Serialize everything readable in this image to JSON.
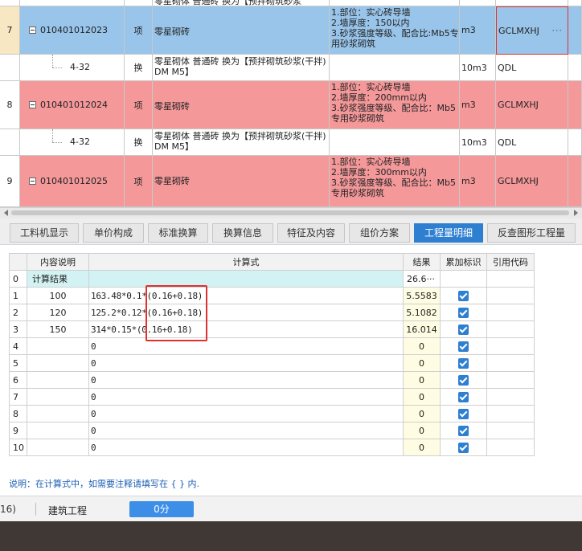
{
  "upper_grid": {
    "rows": [
      {
        "type": "partial",
        "name": "零星砌体 普通砖  换为【预拌砌筑砂浆"
      },
      {
        "type": "main",
        "style": "blue",
        "num": "7",
        "code": "010401012023",
        "category": "项",
        "name": "零星砌砖",
        "features": [
          "1.部位：实心砖导墙",
          "2.墙厚度：150以内",
          "3.砂浆强度等级、配合比:Mb5专用砂浆砌筑"
        ],
        "unit": "m3",
        "expr": "GCLMXHJ"
      },
      {
        "type": "sub",
        "num": "",
        "code": "4-32",
        "category": "换",
        "name": "零星砌体 普通砖  换为【预拌砌筑砂浆(干拌) DM M5】",
        "features": [],
        "unit": "10m3",
        "expr": "QDL"
      },
      {
        "type": "main",
        "style": "red",
        "num": "8",
        "code": "010401012024",
        "category": "项",
        "name": "零星砌砖",
        "features": [
          "1.部位：实心砖导墙",
          "2.墙厚度：200mm以内",
          "3.砂浆强度等级、配合比：Mb5专用砂浆砌筑"
        ],
        "unit": "m3",
        "expr": "GCLMXHJ"
      },
      {
        "type": "sub",
        "num": "",
        "code": "4-32",
        "category": "换",
        "name": "零星砌体 普通砖  换为【预拌砌筑砂浆(干拌) DM M5】",
        "features": [],
        "unit": "10m3",
        "expr": "QDL"
      },
      {
        "type": "main",
        "style": "red",
        "num": "9",
        "code": "010401012025",
        "category": "项",
        "name": "零星砌砖",
        "features": [
          "1.部位：实心砖导墙",
          "2.墙厚度：300mm以内",
          "3.砂浆强度等级、配合比：Mb5专用砂浆砌筑"
        ],
        "unit": "m3",
        "expr": "GCLMXHJ"
      }
    ],
    "selected_expr_dots": "···"
  },
  "tabs": [
    {
      "label": "工料机显示",
      "active": false
    },
    {
      "label": "单价构成",
      "active": false
    },
    {
      "label": "标准换算",
      "active": false
    },
    {
      "label": "换算信息",
      "active": false
    },
    {
      "label": "特征及内容",
      "active": false
    },
    {
      "label": "组价方案",
      "active": false
    },
    {
      "label": "工程量明细",
      "active": true
    },
    {
      "label": "反查图形工程量",
      "active": false
    }
  ],
  "detail_table": {
    "headers": {
      "index": "",
      "desc": "内容说明",
      "expr": "计算式",
      "result": "结果",
      "accum": "累加标识",
      "ref": "引用代码"
    },
    "rows": [
      {
        "index": "0",
        "desc": "计算结果",
        "expr": "",
        "result": "26.6···",
        "checked": false,
        "total": true
      },
      {
        "index": "1",
        "desc": "100",
        "expr": "163.48*0.1*(0.16+0.18)",
        "result": "5.5583",
        "checked": true
      },
      {
        "index": "2",
        "desc": "120",
        "expr": "125.2*0.12*(0.16+0.18)",
        "result": "5.1082",
        "checked": true
      },
      {
        "index": "3",
        "desc": "150",
        "expr": "314*0.15*(0.16+0.18)",
        "result": "16.014",
        "checked": true
      },
      {
        "index": "4",
        "desc": "",
        "expr": "0",
        "result": "0",
        "checked": true
      },
      {
        "index": "5",
        "desc": "",
        "expr": "0",
        "result": "0",
        "checked": true
      },
      {
        "index": "6",
        "desc": "",
        "expr": "0",
        "result": "0",
        "checked": true
      },
      {
        "index": "7",
        "desc": "",
        "expr": "0",
        "result": "0",
        "checked": true
      },
      {
        "index": "8",
        "desc": "",
        "expr": "0",
        "result": "0",
        "checked": true
      },
      {
        "index": "9",
        "desc": "",
        "expr": "0",
        "result": "0",
        "checked": true
      },
      {
        "index": "10",
        "desc": "",
        "expr": "0",
        "result": "0",
        "checked": true
      }
    ]
  },
  "note": "说明：在计算式中，如需要注释请填写在 { } 内.",
  "status_bar": {
    "left_text": "16)",
    "project": "建筑工程",
    "score_button": "0分"
  }
}
